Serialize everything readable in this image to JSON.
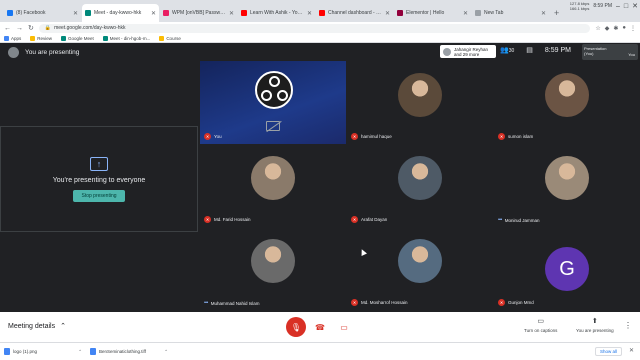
{
  "browser": {
    "tabs": [
      {
        "label": "(8) Facebook",
        "color": "#1877f2",
        "active": false
      },
      {
        "label": "Meet - day-kwwo-hkk",
        "color": "#00897b",
        "active": true
      },
      {
        "label": "WPM [onVBB] Password Modifi...",
        "color": "#e91e63",
        "active": false
      },
      {
        "label": "Learn With Ashik - YouTube",
        "color": "#ff0000",
        "active": false
      },
      {
        "label": "Channel dashboard - YouTube S...",
        "color": "#ff0000",
        "active": false
      },
      {
        "label": "Elementor | Hello",
        "color": "#92003b",
        "active": false
      },
      {
        "label": "New Tab",
        "color": "#9aa0a6",
        "active": false
      }
    ],
    "new_tab": "+",
    "net_speed": "127.8 kbps\n166.1 kbps",
    "time": "8:59 PM",
    "url": "meet.google.com/day-kwwo-hkk",
    "bookmarks": [
      "Apps",
      "Review",
      "Google Meet",
      "Meet - din-hgob-m...",
      "Course"
    ]
  },
  "meet": {
    "presenting_label": "You are presenting",
    "people_chip": "Jahangir Reyhan\nand 29 more",
    "participant_count": "30",
    "clock": "8:59 PM",
    "preview_label": "Presentation\n(You)",
    "preview_you": "You",
    "present_panel": {
      "text": "You're presenting to everyone",
      "button": "Stop presenting"
    },
    "participants": [
      {
        "name": "You",
        "muted": true,
        "kind": "obs"
      },
      {
        "name": "hamimul haque",
        "muted": true,
        "kind": "photo",
        "tone": "#5b4a3a"
      },
      {
        "name": "sumon islam",
        "muted": true,
        "kind": "photo",
        "tone": "#6b5444"
      },
      {
        "name": "Md. Farid Hossain",
        "muted": true,
        "kind": "photo",
        "tone": "#8a7a6a"
      },
      {
        "name": "Arafat Dayan",
        "muted": true,
        "kind": "photo",
        "tone": "#4e5a66"
      },
      {
        "name": "Monirud Jamman",
        "muted": false,
        "kind": "photo",
        "tone": "#9a8a78"
      },
      {
        "name": "Muhammad Nahid Islam",
        "muted": false,
        "kind": "photo",
        "tone": "#6a6a6a"
      },
      {
        "name": "Md. Mosharrof Hossain",
        "muted": true,
        "kind": "photo",
        "tone": "#556b80"
      },
      {
        "name": "Gunjon Mmd",
        "muted": true,
        "kind": "letter",
        "letter": "G"
      }
    ]
  },
  "bottom": {
    "meeting_details": "Meeting details",
    "captions": "Turn on captions",
    "presenting": "You are presenting"
  },
  "downloads": {
    "items": [
      "logo (1).png",
      "BenSeminaticlothing.tiff"
    ],
    "show_all": "Show all"
  }
}
